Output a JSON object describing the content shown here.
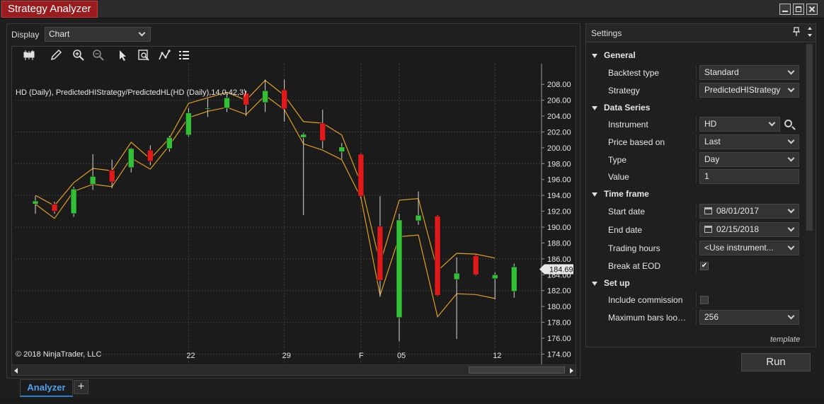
{
  "window": {
    "title": "Strategy Analyzer"
  },
  "display": {
    "label": "Display",
    "value": "Chart"
  },
  "chart": {
    "header": "HD (Daily), PredictedHIStrategy/PredictedHL(HD (Daily),14,0.42,3)",
    "copyright": "© 2018 NinjaTrader, LLC",
    "current_price": "184.69"
  },
  "chart_data": {
    "type": "candlestick",
    "instrument": "HD (Daily)",
    "y_ticks": [
      174,
      176,
      178,
      180,
      182,
      184,
      186,
      188,
      190,
      192,
      194,
      196,
      198,
      200,
      202,
      204,
      206,
      208
    ],
    "y_tick_labels": [
      "174.00",
      "176.00",
      "178.00",
      "180.00",
      "182.00",
      "184.00",
      "186.00",
      "188.00",
      "190.00",
      "192.00",
      "194.00",
      "196.00",
      "198.00",
      "200.00",
      "202.00",
      "204.00",
      "206.00",
      "208.00"
    ],
    "ylim": [
      172.7,
      210.6
    ],
    "x_ticks": [
      {
        "index": 8,
        "label": "22"
      },
      {
        "index": 13,
        "label": "29"
      },
      {
        "index": 17,
        "label": "F"
      },
      {
        "index": 19,
        "label": "05"
      },
      {
        "index": 24,
        "label": "12"
      }
    ],
    "current_price": 184.69,
    "candles": [
      {
        "o": 192.9,
        "c": 193.3,
        "h": 193.9,
        "l": 191.7
      },
      {
        "o": 192.9,
        "c": 192.0,
        "h": 193.2,
        "l": 191.7
      },
      {
        "o": 191.7,
        "c": 194.8,
        "h": 195.1,
        "l": 191.3
      },
      {
        "o": 195.4,
        "c": 196.4,
        "h": 199.2,
        "l": 194.7
      },
      {
        "o": 197.2,
        "c": 195.7,
        "h": 198.5,
        "l": 194.9
      },
      {
        "o": 197.5,
        "c": 199.9,
        "h": 200.0,
        "l": 196.9
      },
      {
        "o": 199.7,
        "c": 198.3,
        "h": 200.3,
        "l": 197.8
      },
      {
        "o": 199.9,
        "c": 201.3,
        "h": 201.5,
        "l": 199.5
      },
      {
        "o": 201.6,
        "c": 204.4,
        "h": 205.0,
        "l": 201.4
      },
      {
        "o": 205.0,
        "c": 205.0,
        "h": 206.2,
        "l": 203.9
      },
      {
        "o": 205.0,
        "c": 206.3,
        "h": 207.0,
        "l": 204.5
      },
      {
        "o": 206.9,
        "c": 205.4,
        "h": 207.2,
        "l": 204.0
      },
      {
        "o": 205.7,
        "c": 207.2,
        "h": 208.6,
        "l": 204.5
      },
      {
        "o": 207.3,
        "c": 204.9,
        "h": 208.6,
        "l": 203.3
      },
      {
        "o": 201.3,
        "c": 201.7,
        "h": 201.9,
        "l": 191.5
      },
      {
        "o": 203.1,
        "c": 200.9,
        "h": 204.8,
        "l": 199.9
      },
      {
        "o": 199.5,
        "c": 200.1,
        "h": 200.6,
        "l": 198.6
      },
      {
        "o": 199.2,
        "c": 193.9,
        "h": 199.3,
        "l": 193.6
      },
      {
        "o": 190.1,
        "c": 183.3,
        "h": 193.9,
        "l": 181.2
      },
      {
        "o": 178.6,
        "c": 190.9,
        "h": 191.7,
        "l": 175.6
      },
      {
        "o": 190.8,
        "c": 191.5,
        "h": 194.5,
        "l": 190.3
      },
      {
        "o": 191.4,
        "c": 181.4,
        "h": 191.5,
        "l": 181.3
      },
      {
        "o": 183.4,
        "c": 184.2,
        "h": 186.2,
        "l": 175.9
      },
      {
        "o": 186.4,
        "c": 184.0,
        "h": 186.5,
        "l": 183.9
      },
      {
        "o": 183.5,
        "c": 184.0,
        "h": 184.3,
        "l": 180.9
      },
      {
        "o": 181.9,
        "c": 185.0,
        "h": 185.4,
        "l": 181.1
      }
    ],
    "upper_band": [
      194.0,
      192.7,
      195.6,
      197.4,
      197.1,
      200.7,
      198.6,
      201.2,
      205.6,
      206.3,
      207.0,
      206.0,
      208.5,
      206.6,
      203.3,
      203.1,
      201.6,
      195.5,
      185.4,
      193.4,
      193.6,
      184.5,
      186.7,
      186.6,
      186.1
    ],
    "lower_band": [
      192.9,
      191.1,
      194.5,
      195.4,
      195.1,
      198.7,
      197.3,
      200.3,
      203.8,
      204.6,
      205.1,
      204.2,
      206.6,
      204.8,
      200.5,
      199.7,
      198.5,
      193.7,
      181.4,
      188.8,
      189.0,
      178.7,
      181.6,
      181.5,
      181.0
    ],
    "colors": {
      "up": "#32c036",
      "down": "#e01a1a",
      "band": "#e0a020",
      "grid": "#3d3d3d",
      "wick": "#d8d8d8"
    }
  },
  "settings": {
    "title": "Settings",
    "categories": {
      "general": "General",
      "data_series": "Data Series",
      "time_frame": "Time frame",
      "set_up": "Set up"
    },
    "props": {
      "backtest_type": {
        "label": "Backtest type",
        "value": "Standard"
      },
      "strategy": {
        "label": "Strategy",
        "value": "PredictedHIStrategy"
      },
      "instrument": {
        "label": "Instrument",
        "value": "HD"
      },
      "price_based_on": {
        "label": "Price based on",
        "value": "Last"
      },
      "type": {
        "label": "Type",
        "value": "Day"
      },
      "value": {
        "label": "Value",
        "value": "1"
      },
      "start_date": {
        "label": "Start date",
        "value": "08/01/2017"
      },
      "end_date": {
        "label": "End date",
        "value": "02/15/2018"
      },
      "trading_hours": {
        "label": "Trading hours",
        "value": "<Use instrument..."
      },
      "break_at_eod": {
        "label": "Break at EOD",
        "checked": true
      },
      "include_commission": {
        "label": "Include commission",
        "checked": false
      },
      "max_bars": {
        "label": "Maximum bars loo…",
        "value": "256"
      }
    },
    "template_label": "template",
    "run_label": "Run"
  },
  "tabs": {
    "analyzer": "Analyzer",
    "add": "+"
  },
  "icons": {
    "check": "✔"
  }
}
